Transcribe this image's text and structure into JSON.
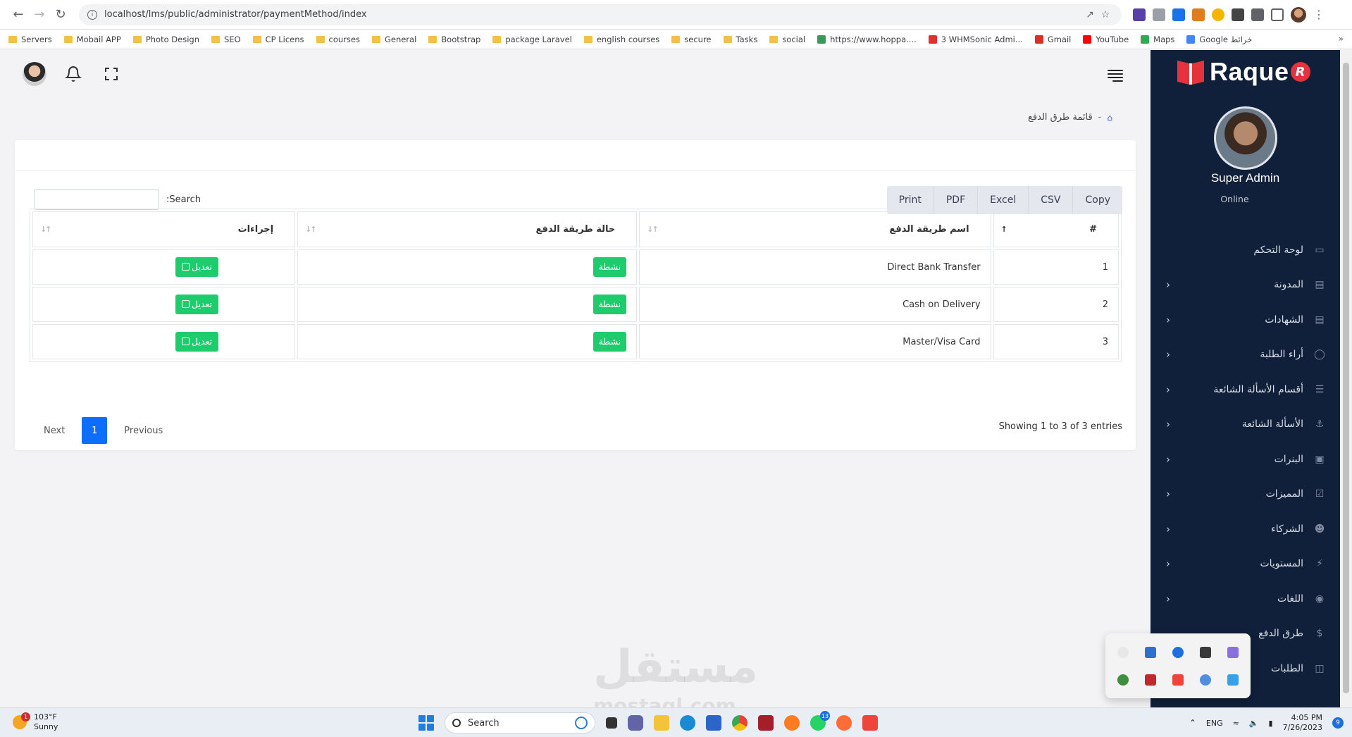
{
  "browser": {
    "url": "localhost/lms/public/administrator/paymentMethod/index",
    "bookmarks": [
      {
        "label": "Servers",
        "type": "folder"
      },
      {
        "label": "Mobail APP",
        "type": "folder"
      },
      {
        "label": "Photo Design",
        "type": "folder"
      },
      {
        "label": "SEO",
        "type": "folder"
      },
      {
        "label": "CP Licens",
        "type": "folder"
      },
      {
        "label": "courses",
        "type": "folder"
      },
      {
        "label": "General",
        "type": "folder"
      },
      {
        "label": "Bootstrap",
        "type": "folder"
      },
      {
        "label": "package Laravel",
        "type": "folder"
      },
      {
        "label": "english courses",
        "type": "folder"
      },
      {
        "label": "secure",
        "type": "folder"
      },
      {
        "label": "Tasks",
        "type": "folder"
      },
      {
        "label": "social",
        "type": "folder"
      },
      {
        "label": "https://www.hoppa....",
        "type": "link",
        "color": "#3a9a5b"
      },
      {
        "label": "3 WHMSonic Admi...",
        "type": "link",
        "color": "#e0312f"
      },
      {
        "label": "Gmail",
        "type": "link",
        "color": "#d93025"
      },
      {
        "label": "YouTube",
        "type": "link",
        "color": "#ff0000"
      },
      {
        "label": "Maps",
        "type": "link",
        "color": "#34a853"
      },
      {
        "label": "Google خرائط",
        "type": "link",
        "color": "#4285f4"
      }
    ],
    "bookmarks_more": "»"
  },
  "breadcrumb": {
    "separator": "-",
    "current": "قائمة طرق الدفع"
  },
  "toolbar": {
    "search_label": ":Search",
    "buttons": [
      "Copy",
      "CSV",
      "Excel",
      "PDF",
      "Print"
    ]
  },
  "table": {
    "headers": [
      "#",
      "اسم طريقة الدفع",
      "حالة طريقة الدفع",
      "إجراءات"
    ],
    "rows": [
      {
        "num": "1",
        "name": "Direct Bank Transfer",
        "status": "نشطة",
        "action": "تعديل"
      },
      {
        "num": "2",
        "name": "Cash on Delivery",
        "status": "نشطة",
        "action": "تعديل"
      },
      {
        "num": "3",
        "name": "Master/Visa Card",
        "status": "نشطة",
        "action": "تعديل"
      }
    ]
  },
  "footer": {
    "info": "Showing 1 to 3 of 3 entries",
    "next": "Next",
    "current_page": "1",
    "previous": "Previous"
  },
  "sidebar": {
    "logo_text": "Raque",
    "logo_badge": "R",
    "user_name": "Super Admin",
    "user_status": "Online",
    "items": [
      {
        "label": "لوحة التحكم",
        "icon": "monitor-icon",
        "has_children": false
      },
      {
        "label": "المدونة",
        "icon": "book-icon",
        "has_children": true
      },
      {
        "label": "الشهادات",
        "icon": "book-icon",
        "has_children": true
      },
      {
        "label": "أراء الطلبة",
        "icon": "award-icon",
        "has_children": true
      },
      {
        "label": "أقسام الأسألة الشائعة",
        "icon": "list-icon",
        "has_children": true
      },
      {
        "label": "الأسألة الشائعة",
        "icon": "anchor-icon",
        "has_children": true
      },
      {
        "label": "البنرات",
        "icon": "image-icon",
        "has_children": true
      },
      {
        "label": "المميزات",
        "icon": "check-square-icon",
        "has_children": true
      },
      {
        "label": "الشركاء",
        "icon": "user-icon",
        "has_children": true
      },
      {
        "label": "المستويات",
        "icon": "zap-icon",
        "has_children": true
      },
      {
        "label": "اللغات",
        "icon": "globe-icon",
        "has_children": true
      },
      {
        "label": "طرق الدفع",
        "icon": "dollar-icon",
        "has_children": false
      },
      {
        "label": "الطلبات",
        "icon": "cart-icon",
        "has_children": false
      }
    ]
  },
  "watermark": {
    "ar": "مستقل",
    "en": "mostaql.com"
  },
  "taskbar": {
    "weather_temp": "103°F",
    "weather_desc": "Sunny",
    "weather_badge": "1",
    "search_placeholder": "Search",
    "whatsapp_badge": "13",
    "lang": "ENG",
    "time": "4:05 PM",
    "date": "7/26/2023",
    "notifications": "9"
  },
  "colors": {
    "sidebar_bg": "#101f3a",
    "success": "#1ecc6d",
    "primary": "#0d6efd",
    "logo_red": "#e5323c"
  }
}
